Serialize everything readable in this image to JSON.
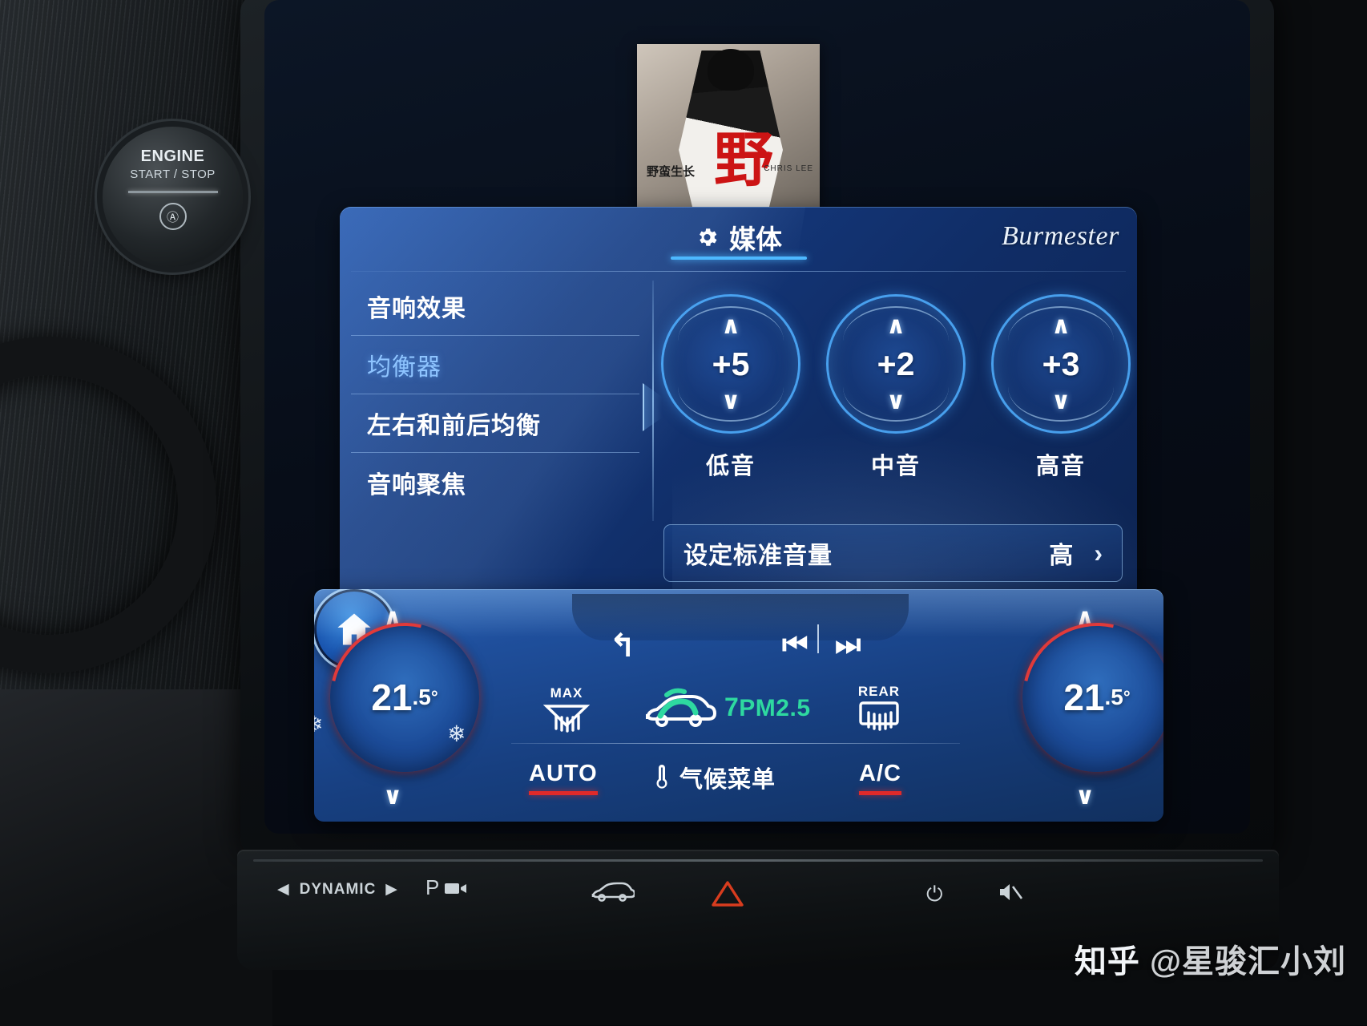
{
  "vehicle": {
    "engine_button": {
      "line1": "ENGINE",
      "line2": "START / STOP",
      "icon": "auto-stop-icon",
      "icon_glyph": "Ⓐ"
    }
  },
  "album_art": {
    "title_cn": "野蛮生长",
    "artist": "CHRIS LEE",
    "big_char": "野"
  },
  "media_panel": {
    "header": {
      "icon": "gear-icon",
      "title": "媒体",
      "brand": "Burmester"
    },
    "menu": [
      {
        "label": "音响效果",
        "selected": false
      },
      {
        "label": "均衡器",
        "selected": true
      },
      {
        "label": "左右和前后均衡",
        "selected": false
      },
      {
        "label": "音响聚焦",
        "selected": false
      }
    ],
    "equalizer": [
      {
        "label": "低音",
        "value": "+5"
      },
      {
        "label": "中音",
        "value": "+2"
      },
      {
        "label": "高音",
        "value": "+3"
      }
    ],
    "standard_volume": {
      "label": "设定标准音量",
      "value": "高",
      "arrow": "›"
    }
  },
  "nav_bar": {
    "back": "↰",
    "home": "home-icon",
    "prev": "⏮",
    "next": "⏭"
  },
  "climate": {
    "left_temp": {
      "whole": "21",
      "frac": ".5",
      "unit": "°"
    },
    "right_temp": {
      "whole": "21",
      "frac": ".5",
      "unit": "°"
    },
    "defrost": "MAX",
    "rear_defrost": "REAR",
    "air_quality": {
      "number": "7",
      "label": "PM2.5",
      "color": "#2ed9a0"
    },
    "buttons": [
      {
        "label": "AUTO",
        "active": true
      },
      {
        "label": "气候菜单",
        "active": false,
        "icon": "thermometer-icon"
      },
      {
        "label": "A/C",
        "active": true
      }
    ],
    "accent_color": "#e02a2a"
  },
  "hard_keys": {
    "dynamic": {
      "left_arrow": "◀",
      "label": "DYNAMIC",
      "right_arrow": "▶"
    },
    "park_camera": "P",
    "vehicle": "car-icon",
    "hazard": "hazard-icon",
    "power": "⏻",
    "mute": "mute-icon"
  },
  "watermark": {
    "site": "知乎",
    "handle": "@星骏汇小刘"
  }
}
